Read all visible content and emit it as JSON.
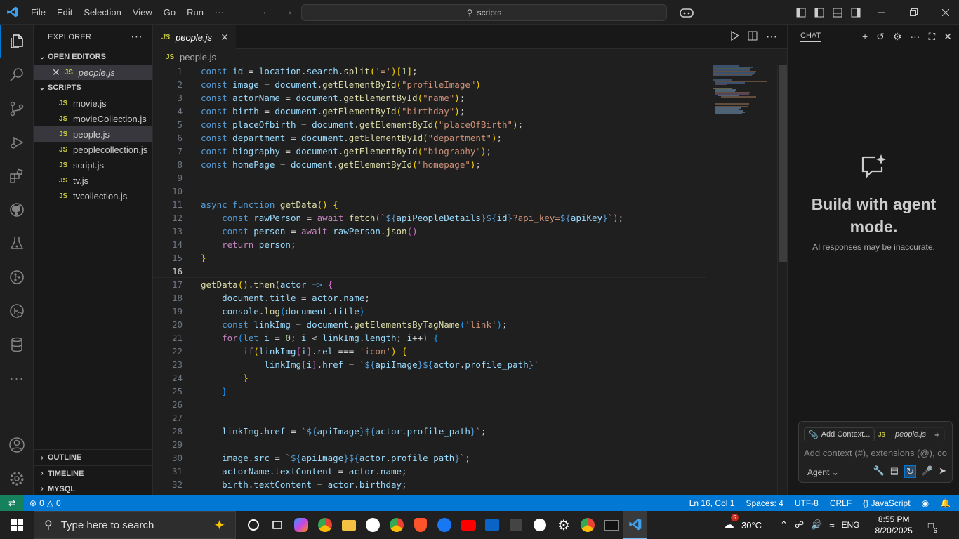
{
  "menu": [
    "File",
    "Edit",
    "Selection",
    "View",
    "Go",
    "Run",
    "···"
  ],
  "search_label": "scripts",
  "sidebar": {
    "title": "EXPLORER",
    "open_editors": "OPEN EDITORS",
    "open_file": "people.js",
    "folder": "SCRIPTS",
    "files": [
      "movie.js",
      "movieCollection.js",
      "people.js",
      "peoplecollection.js",
      "script.js",
      "tv.js",
      "tvcollection.js"
    ],
    "outline": "OUTLINE",
    "timeline": "TIMELINE",
    "mysql": "MYSQL"
  },
  "tab": {
    "label": "people.js",
    "lang": "JS"
  },
  "breadcrumb": "people.js",
  "line_numbers": [
    "1",
    "2",
    "3",
    "4",
    "5",
    "6",
    "7",
    "8",
    "9",
    "10",
    "11",
    "12",
    "13",
    "14",
    "15",
    "16",
    "17",
    "18",
    "19",
    "20",
    "21",
    "22",
    "23",
    "24",
    "25",
    "26",
    "27",
    "28",
    "29",
    "30",
    "31",
    "32"
  ],
  "chat": {
    "title": "CHAT",
    "heading": "Build with agent mode.",
    "subtitle": "AI responses may be inaccurate.",
    "add_context": "Add Context...",
    "file_chip": "people.js",
    "placeholder": "Add context (#), extensions (@), co",
    "mode": "Agent"
  },
  "status": {
    "problems": "0",
    "warnings": "0",
    "position": "Ln 16, Col 1",
    "spaces": "Spaces: 4",
    "encoding": "UTF-8",
    "eol": "CRLF",
    "language": "JavaScript"
  },
  "taskbar": {
    "search_placeholder": "Type here to search",
    "temperature": "30°C",
    "lang": "ENG",
    "time": "8:55 PM",
    "date": "8/20/2025",
    "notifications": "6",
    "weather_badge": "5"
  },
  "colors": {
    "accent": "#0078d4",
    "status_bar": "#0078d4",
    "remote": "#16825d"
  }
}
